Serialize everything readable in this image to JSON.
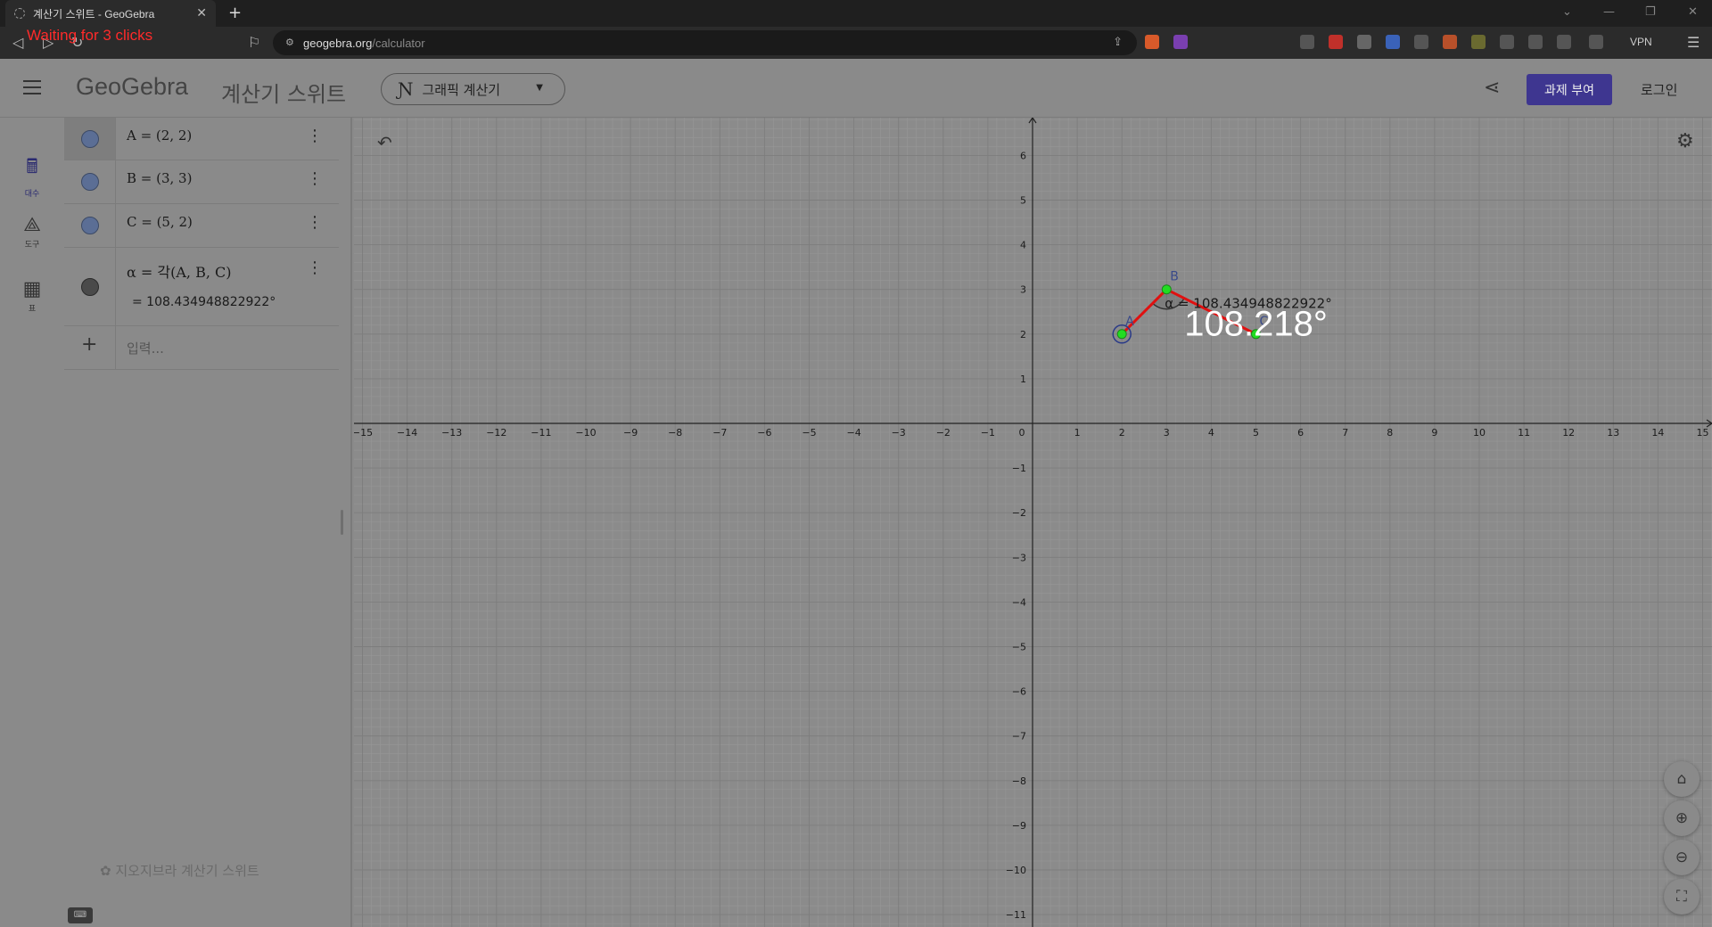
{
  "browser": {
    "tab_title": "계산기 스위트 - GeoGebra",
    "tab_close": "✕",
    "new_tab": "+",
    "overlay_text": "Waiting for 3 clicks",
    "url_host": "geogebra.org",
    "url_path": "/calculator",
    "vpn_label": "VPN"
  },
  "header": {
    "logo": "GeoGebra",
    "suite_title": "계산기 스위트",
    "app_select": "그래픽 계산기",
    "assign_button": "과제 부여",
    "login": "로그인"
  },
  "rail": {
    "items": [
      {
        "label": "대수",
        "icon": "calculator-icon",
        "glyph": "🖩"
      },
      {
        "label": "도구",
        "icon": "tools-icon",
        "glyph": "⟁"
      },
      {
        "label": "표",
        "icon": "table-icon",
        "glyph": "▦"
      }
    ]
  },
  "algebra": {
    "items": [
      {
        "expr": "A = (2, 2)"
      },
      {
        "expr": "B = (3, 3)"
      },
      {
        "expr": "C = (5, 2)"
      },
      {
        "expr": "α = 각(A, B, C)",
        "result": "=  108.434948822922°"
      }
    ],
    "input_placeholder": "입력...",
    "footer": "지오지브라 계산기 스위트"
  },
  "graph": {
    "x_range": [
      -15,
      15
    ],
    "y_range": [
      -11,
      6
    ],
    "points": [
      {
        "name": "A",
        "x": 2,
        "y": 2
      },
      {
        "name": "B",
        "x": 3,
        "y": 3
      },
      {
        "name": "C",
        "x": 5,
        "y": 2
      }
    ],
    "angle_label": "α = 108.434948822922°",
    "measure_label": "108.218°",
    "colors": {
      "segment": "#e01010",
      "point": "#22dd22",
      "point_outline": "#2a3a88",
      "grid_minor": "#999999",
      "grid_major": "#7d7d7d",
      "axis": "#222222"
    }
  }
}
